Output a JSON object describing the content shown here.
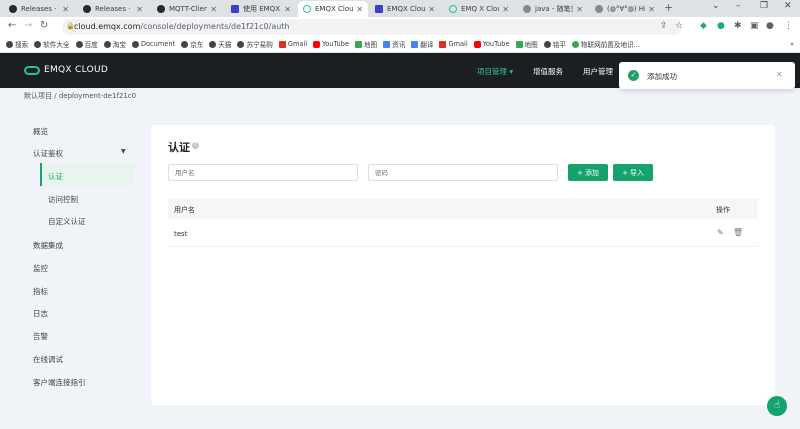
{
  "browser": {
    "tabs": [
      {
        "label": "Releases · em",
        "icon": "github-icon"
      },
      {
        "label": "Releases · em",
        "icon": "github-icon"
      },
      {
        "label": "MQTT-Clien",
        "icon": "github-icon"
      },
      {
        "label": "使用 EMQX C",
        "icon": "doc-icon"
      },
      {
        "label": "EMQX Cloud",
        "icon": "emqx-icon"
      },
      {
        "label": "EMQX Cloud",
        "icon": "doc-icon"
      },
      {
        "label": "EMQ X Cloud",
        "icon": "emqx-icon"
      },
      {
        "label": "java - 随笔分",
        "icon": "blog-icon"
      },
      {
        "label": "(◍°∀°◍) Hi, E",
        "icon": "blog-icon"
      }
    ],
    "new_tab": "+",
    "url_host": "cloud.emqx.com",
    "url_path": "/console/deployments/de1f21c0/auth",
    "bookmarks": [
      {
        "label": "搜索",
        "color": "#444"
      },
      {
        "label": "软件大全",
        "color": "#444"
      },
      {
        "label": "百度",
        "color": "#444"
      },
      {
        "label": "淘宝",
        "color": "#444"
      },
      {
        "label": "Document",
        "color": "#444"
      },
      {
        "label": "京东",
        "color": "#444"
      },
      {
        "label": "天猫",
        "color": "#444"
      },
      {
        "label": "苏宁易购",
        "color": "#444"
      },
      {
        "label": "Gmail",
        "color": "#d93025"
      },
      {
        "label": "YouTube",
        "color": "#ff0000"
      },
      {
        "label": "地图",
        "color": "#34a853"
      },
      {
        "label": "资讯",
        "color": "#4285f4"
      },
      {
        "label": "翻译",
        "color": "#4285f4"
      },
      {
        "label": "Gmail",
        "color": "#d93025"
      },
      {
        "label": "YouTube",
        "color": "#ff0000"
      },
      {
        "label": "地图",
        "color": "#34a853"
      },
      {
        "label": "铭平",
        "color": "#444"
      },
      {
        "label": "物联网前置及地识...",
        "color": "#34a853"
      }
    ],
    "bookmarks_more": "»"
  },
  "app": {
    "logo_text": "EMQX CLOUD",
    "nav": {
      "project": "项目管理 ▾",
      "value_added": "增值服务",
      "user_mgmt": "用户管理"
    },
    "breadcrumb": {
      "root": "默认项目",
      "sep": "/",
      "current": "deployment-de1f21c0"
    },
    "sidebar": {
      "overview": "概览",
      "auth_group": "认证鉴权",
      "auth": "认证",
      "acl": "访问控制",
      "custom_auth": "自定义认证",
      "data_integration": "数据集成",
      "monitor": "监控",
      "metrics": "指标",
      "logs": "日志",
      "alerts": "告警",
      "online_debug": "在线调试",
      "client_guide": "客户端连接指引"
    },
    "main": {
      "title": "认证",
      "username_placeholder": "用户名",
      "password_placeholder": "密码",
      "add_label": "添加",
      "import_label": "导入",
      "columns": {
        "username": "用户名",
        "actions": "操作"
      },
      "rows": [
        {
          "username": "test"
        }
      ]
    },
    "toast": {
      "message": "添加成功"
    },
    "accent": "#13a36b"
  }
}
